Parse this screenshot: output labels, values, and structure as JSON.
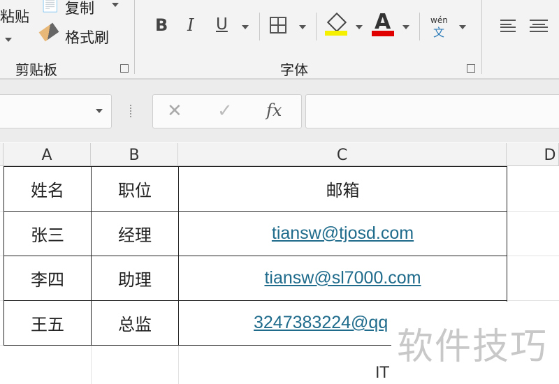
{
  "ribbon": {
    "clipboard": {
      "paste_label": "粘贴",
      "copy_label": "复制",
      "format_painter_label": "格式刷",
      "group_label": "剪贴板"
    },
    "font": {
      "bold": "B",
      "italic": "I",
      "underline": "U",
      "font_color_letter": "A",
      "phonetic_top": "wén",
      "phonetic_bottom": "文",
      "group_label": "字体",
      "fill_color": "#f5f000",
      "font_color": "#e00000"
    }
  },
  "formula_bar": {
    "cancel": "✕",
    "enter": "✓",
    "fx": "fx",
    "value": ""
  },
  "columns": [
    "A",
    "B",
    "C",
    "D"
  ],
  "rows": [
    [
      "姓名",
      "职位",
      "邮箱"
    ],
    [
      "张三",
      "经理",
      "tiansw@tjosd.com"
    ],
    [
      "李四",
      "助理",
      "tiansw@sl7000.com"
    ],
    [
      "王五",
      "总监",
      "3247383224@qq"
    ]
  ],
  "watermark": {
    "text": "软件技巧",
    "sub": "IT"
  }
}
